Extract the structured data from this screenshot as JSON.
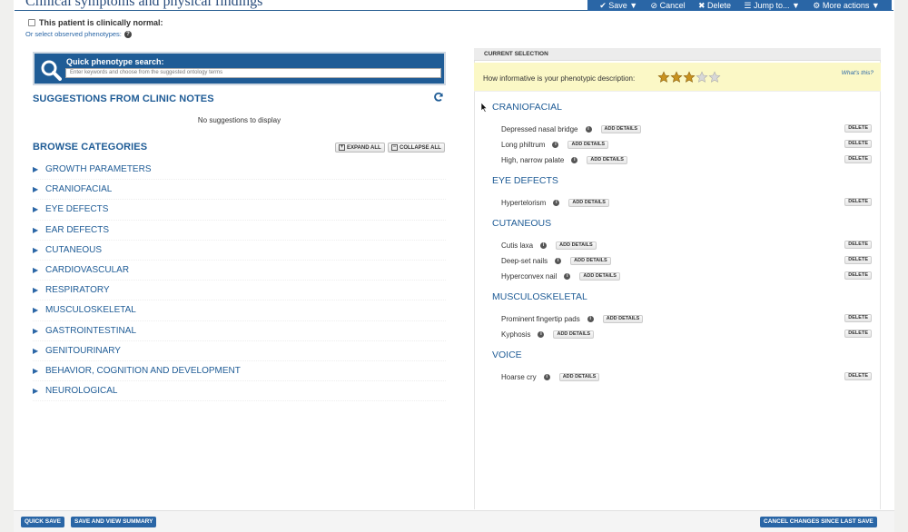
{
  "page": {
    "title": "Clinical symptoms and physical findings"
  },
  "toolbar": {
    "save": "✔ Save ▼",
    "cancel": "⊘ Cancel",
    "delete": "✖ Delete",
    "jump": "☰ Jump to... ▼",
    "more": "⚙ More actions ▼"
  },
  "normal": {
    "label": "This patient is clinically normal:"
  },
  "select_phenotypes": {
    "label": "Or select observed phenotypes:"
  },
  "quick_search": {
    "label": "Quick phenotype search:",
    "placeholder": "Enter keywords and choose from the suggested ontology terms"
  },
  "suggestions": {
    "heading": "SUGGESTIONS FROM CLINIC NOTES",
    "empty": "No suggestions to display"
  },
  "browse": {
    "heading": "BROWSE CATEGORIES",
    "expand_all": "EXPAND ALL",
    "collapse_all": "COLLAPSE ALL",
    "categories": [
      "GROWTH PARAMETERS",
      "CRANIOFACIAL",
      "EYE DEFECTS",
      "EAR DEFECTS",
      "CUTANEOUS",
      "CARDIOVASCULAR",
      "RESPIRATORY",
      "MUSCULOSKELETAL",
      "GASTROINTESTINAL",
      "GENITOURINARY",
      "BEHAVIOR, COGNITION AND DEVELOPMENT",
      "NEUROLOGICAL"
    ]
  },
  "current": {
    "heading": "CURRENT SELECTION",
    "info_text": "How informative is your phenotypic description:",
    "whats_this": "What's this?",
    "stars_filled": 3,
    "stars_total": 5,
    "add_details": "ADD DETAILS",
    "delete": "DELETE",
    "sections": [
      {
        "title": "CRANIOFACIAL",
        "items": [
          "Depressed nasal bridge",
          "Long philtrum",
          "High, narrow palate"
        ]
      },
      {
        "title": "EYE DEFECTS",
        "items": [
          "Hypertelorism"
        ]
      },
      {
        "title": "CUTANEOUS",
        "items": [
          "Cutis laxa",
          "Deep-set nails",
          "Hyperconvex nail"
        ]
      },
      {
        "title": "MUSCULOSKELETAL",
        "items": [
          "Prominent fingertip pads",
          "Kyphosis"
        ]
      },
      {
        "title": "VOICE",
        "items": [
          "Hoarse cry"
        ]
      }
    ]
  },
  "bottom": {
    "quick_save": "QUICK SAVE",
    "save_view": "SAVE AND VIEW SUMMARY",
    "cancel_changes": "CANCEL CHANGES SINCE LAST SAVE"
  },
  "colors": {
    "brand": "#1f5c96",
    "toolbar": "#2a66a6",
    "info_bar": "#fbf8c6"
  }
}
